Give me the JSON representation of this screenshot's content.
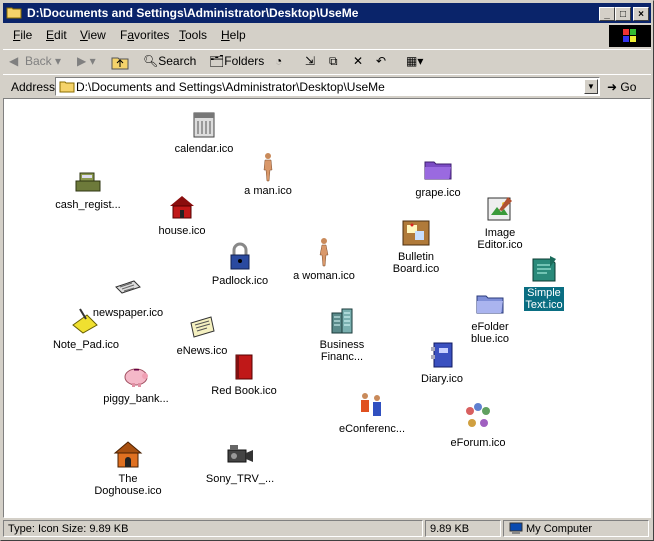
{
  "window": {
    "title": "D:\\Documents and Settings\\Administrator\\Desktop\\UseMe"
  },
  "menu": [
    {
      "pre": "",
      "u": "F",
      "post": "ile"
    },
    {
      "pre": "",
      "u": "E",
      "post": "dit"
    },
    {
      "pre": "",
      "u": "V",
      "post": "iew"
    },
    {
      "pre": "F",
      "u": "a",
      "post": "vorites"
    },
    {
      "pre": "",
      "u": "T",
      "post": "ools"
    },
    {
      "pre": "",
      "u": "H",
      "post": "elp"
    }
  ],
  "toolbar": {
    "back": "Back",
    "search": "Search",
    "folders": "Folders"
  },
  "address": {
    "label": "Address",
    "value": "D:\\Documents and Settings\\Administrator\\Desktop\\UseMe",
    "go": "Go"
  },
  "icons": [
    {
      "label": "calendar.ico",
      "icon": "calendar-icon"
    },
    {
      "label": "a man.ico",
      "icon": "man-figure-icon"
    },
    {
      "label": "grape.ico",
      "icon": "purple-folder-icon"
    },
    {
      "label": "cash_regist...",
      "icon": "cash-register-icon"
    },
    {
      "label": "house.ico",
      "icon": "house-icon"
    },
    {
      "label": "Image\nEditor.ico",
      "icon": "image-editor-icon"
    },
    {
      "label": "Bulletin\nBoard.ico",
      "icon": "bulletin-board-icon"
    },
    {
      "label": "a woman.ico",
      "icon": "woman-figure-icon"
    },
    {
      "label": "Padlock.ico",
      "icon": "padlock-icon"
    },
    {
      "label": "Simple\nText.ico",
      "icon": "simple-text-icon"
    },
    {
      "label": "newspaper.ico",
      "icon": "newspaper-icon"
    },
    {
      "label": "eFolder\nblue.ico",
      "icon": "blue-folder-icon"
    },
    {
      "label": "Note_Pad.ico",
      "icon": "notepad-icon"
    },
    {
      "label": "eNews.ico",
      "icon": "enews-icon"
    },
    {
      "label": "Business\nFinanc...",
      "icon": "business-buildings-icon"
    },
    {
      "label": "Diary.ico",
      "icon": "diary-icon"
    },
    {
      "label": "piggy_bank...",
      "icon": "piggy-bank-icon"
    },
    {
      "label": "Red Book.ico",
      "icon": "red-book-icon"
    },
    {
      "label": "eConferenc...",
      "icon": "conference-people-icon"
    },
    {
      "label": "eForum.ico",
      "icon": "forum-people-icon"
    },
    {
      "label": "The\nDoghouse.ico",
      "icon": "doghouse-icon"
    },
    {
      "label": "Sony_TRV_...",
      "icon": "camcorder-icon"
    }
  ],
  "status": {
    "type": "Type: Icon Size: 9.89 KB",
    "size": "9.89 KB",
    "zone": "My Computer"
  }
}
